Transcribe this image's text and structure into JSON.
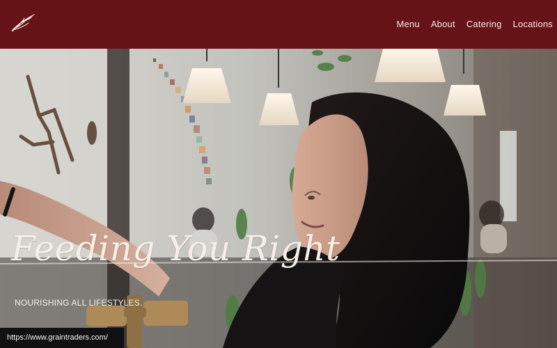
{
  "header": {
    "logo": {
      "icon": "feather-logo-icon",
      "colors": {
        "header_bg": "#661317",
        "text": "#f4ece6"
      }
    },
    "nav": [
      {
        "label": "Menu"
      },
      {
        "label": "About"
      },
      {
        "label": "Catering"
      },
      {
        "label": "Locations"
      }
    ]
  },
  "hero": {
    "headline": "Feeding You Right",
    "subheadline": "NOURISHING ALL LIFESTYLES.",
    "accent_color": "#f7efe7"
  },
  "footer": {
    "url": "https://www.graintraders.com/"
  }
}
